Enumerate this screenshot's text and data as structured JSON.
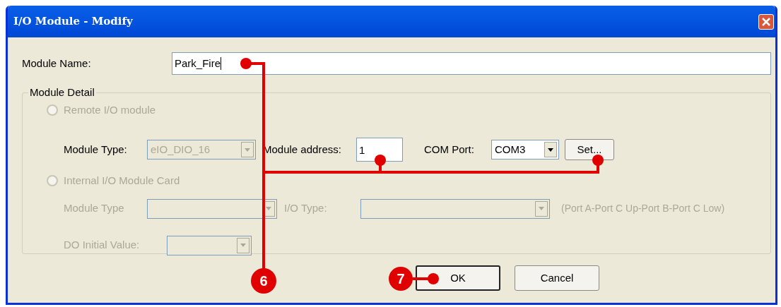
{
  "window": {
    "title": "I/O Module - Modify"
  },
  "module_name": {
    "label": "Module Name:",
    "value": "Park_Fire"
  },
  "module_detail": {
    "title": "Module Detail",
    "remote": {
      "label": "Remote I/O module",
      "selected": false,
      "disabled": true,
      "module_type": {
        "label": "Module Type:",
        "value": "eIO_DIO_16",
        "disabled": true
      },
      "module_address": {
        "label": "Module address:",
        "value": "1"
      },
      "com_port": {
        "label": "COM Port:",
        "value": "COM3"
      },
      "set_button": "Set..."
    },
    "internal": {
      "label": "Internal I/O Module Card",
      "selected": false,
      "disabled": true,
      "module_type": {
        "label": "Module Type",
        "disabled": true
      },
      "io_type": {
        "label": "I/O Type:",
        "disabled": true
      },
      "io_type_hint": "(Port A-Port C Up-Port B-Port C Low)",
      "do_initial_value": {
        "label": "DO Initial Value:",
        "disabled": true
      }
    }
  },
  "buttons": [
    {
      "label": "OK",
      "default": true
    },
    {
      "label": "Cancel",
      "default": false
    }
  ],
  "callouts": [
    {
      "label": "6"
    },
    {
      "label": "7"
    }
  ]
}
